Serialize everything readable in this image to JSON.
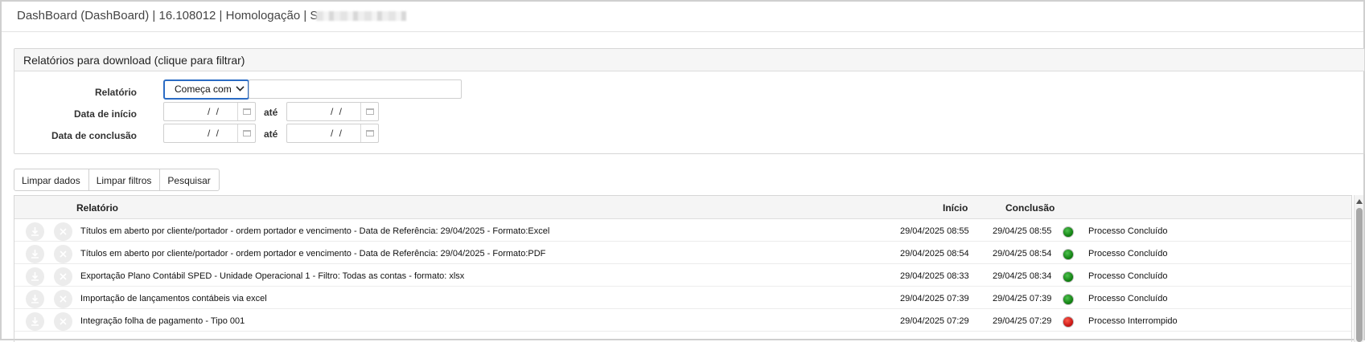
{
  "titlebar": {
    "title": "DashBoard (DashBoard) | 16.108012 | Homologação | S"
  },
  "filter_panel": {
    "header": "Relatórios para download (clique para filtrar)",
    "relatorio_label": "Relatório",
    "relatorio_operator": "Começa com",
    "relatorio_value": "",
    "data_inicio_label": "Data de início",
    "data_conclusao_label": "Data de conclusão",
    "ate_label": "até",
    "date_empty": "/ /"
  },
  "buttons": {
    "limpar_dados": "Limpar dados",
    "limpar_filtros": "Limpar filtros",
    "pesquisar": "Pesquisar"
  },
  "grid": {
    "columns": {
      "relatorio": "Relatório",
      "inicio": "Início",
      "conclusao": "Conclusão"
    },
    "rows": [
      {
        "relatorio": "Títulos em aberto por cliente/portador - ordem portador e vencimento - Data de Referência: 29/04/2025 - Formato:Excel",
        "inicio": "29/04/2025 08:55",
        "conclusao": "29/04/25 08:55",
        "status_color": "green",
        "status": "Processo Concluído"
      },
      {
        "relatorio": "Títulos em aberto por cliente/portador - ordem portador e vencimento - Data de Referência: 29/04/2025 - Formato:PDF",
        "inicio": "29/04/2025 08:54",
        "conclusao": "29/04/25 08:54",
        "status_color": "green",
        "status": "Processo Concluído"
      },
      {
        "relatorio": "Exportação Plano Contábil SPED - Unidade Operacional 1 - Filtro: Todas as contas - formato: xlsx",
        "inicio": "29/04/2025 08:33",
        "conclusao": "29/04/25 08:34",
        "status_color": "green",
        "status": "Processo Concluído"
      },
      {
        "relatorio": "Importação de lançamentos contábeis via excel",
        "inicio": "29/04/2025 07:39",
        "conclusao": "29/04/25 07:39",
        "status_color": "green",
        "status": "Processo Concluído"
      },
      {
        "relatorio": "Integração folha de pagamento - Tipo 001",
        "inicio": "29/04/2025 07:29",
        "conclusao": "29/04/25 07:29",
        "status_color": "red",
        "status": "Processo Interrompido"
      }
    ]
  }
}
